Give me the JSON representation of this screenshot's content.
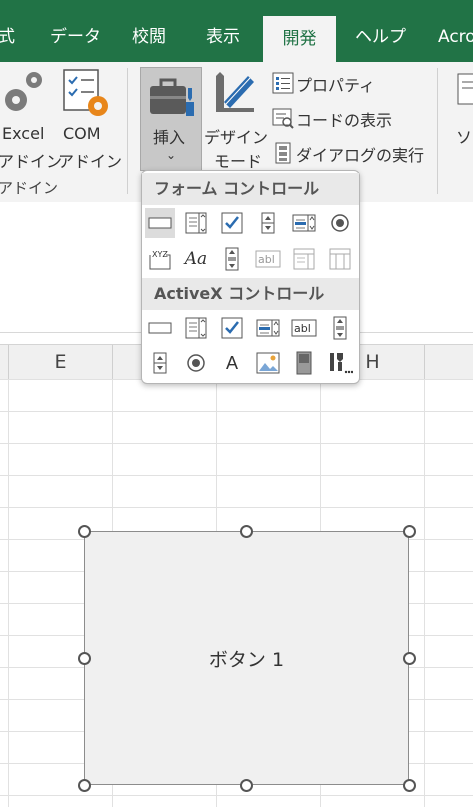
{
  "tabs": [
    {
      "label": "式"
    },
    {
      "label": "データ"
    },
    {
      "label": "校閲"
    },
    {
      "label": "表示"
    },
    {
      "label": "開発",
      "active": true
    },
    {
      "label": "ヘルプ"
    },
    {
      "label": "Acro"
    }
  ],
  "ribbon": {
    "addins": {
      "excel_line1": "Excel",
      "excel_line2": "アドイン",
      "com_line1": "COM",
      "com_line2": "アドイン",
      "group_label": "アドイン"
    },
    "insert_label": "挿入",
    "design_line1": "デザイン",
    "design_line2": "モード",
    "properties": "プロパティ",
    "view_code": "コードの表示",
    "dialog": "ダイアログの実行",
    "right_partial": "ソ"
  },
  "columns": [
    "E",
    "H"
  ],
  "dropdown": {
    "form_header": "フォーム コントロール",
    "activex_header": "ActiveX コントロール",
    "form_row1": [
      "button-control-icon",
      "combo-box-icon",
      "checkbox-icon",
      "spin-button-icon",
      "list-box-icon",
      "option-button-icon"
    ],
    "form_row2": [
      "group-box-icon",
      "label-control-icon",
      "scroll-bar-icon",
      "text-field-icon",
      "combo-list-edit-icon",
      "combo-dropdown-edit-icon"
    ],
    "activex_row1": [
      "button-control-icon",
      "combo-box-icon",
      "checkbox-icon",
      "list-box-icon",
      "text-box-icon",
      "scroll-bar-icon"
    ],
    "activex_row2": [
      "spin-button-icon",
      "option-button-icon",
      "label-control-icon",
      "image-icon",
      "toggle-button-icon",
      "more-controls-icon"
    ],
    "glyph_label": "A",
    "glyph_label_italic": "Aa",
    "glyph_text": "abl",
    "glyph_xyz": "XYZ"
  },
  "shape": {
    "label": "ボタン 1"
  },
  "colors": {
    "brand_green": "#217346",
    "checkbox_blue": "#2b6cb0"
  }
}
